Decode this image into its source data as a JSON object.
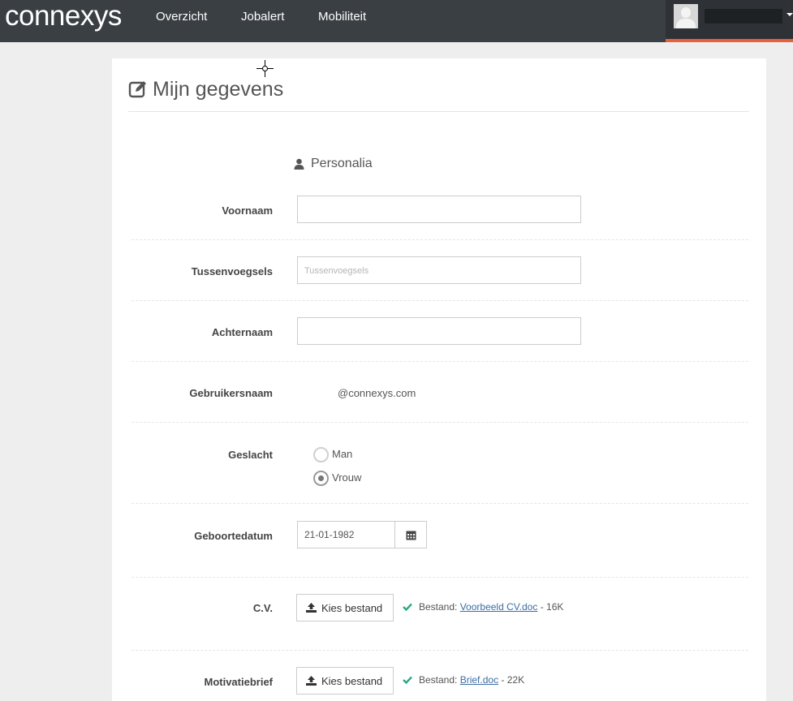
{
  "navbar": {
    "logo": "connexys",
    "items": [
      "Overzicht",
      "Jobalert",
      "Mobiliteit"
    ]
  },
  "page": {
    "title": "Mijn gegevens",
    "section": "Personalia"
  },
  "form": {
    "voornaam": {
      "label": "Voornaam",
      "value": "",
      "placeholder": ""
    },
    "tussenvoegsels": {
      "label": "Tussenvoegsels",
      "value": "",
      "placeholder": "Tussenvoegsels"
    },
    "achternaam": {
      "label": "Achternaam",
      "value": "",
      "placeholder": ""
    },
    "gebruikersnaam": {
      "label": "Gebruikersnaam",
      "value": "@connexys.com"
    },
    "geslacht": {
      "label": "Geslacht",
      "options": [
        "Man",
        "Vrouw"
      ],
      "selected": "Vrouw"
    },
    "geboortedatum": {
      "label": "Geboortedatum",
      "value": "21-01-1982"
    },
    "cv": {
      "label": "C.V.",
      "button": "Kies bestand",
      "prefix": "Bestand:",
      "file": "Voorbeeld CV.doc",
      "size": "- 16K"
    },
    "motivatiebrief": {
      "label": "Motivatiebrief",
      "button": "Kies bestand",
      "prefix": "Bestand:",
      "file": "Brief.doc",
      "size": "- 22K"
    }
  },
  "colors": {
    "navbar": "#3a3f44",
    "accent": "#e5603b",
    "check": "#2aa985",
    "link": "#3a6ea5"
  }
}
